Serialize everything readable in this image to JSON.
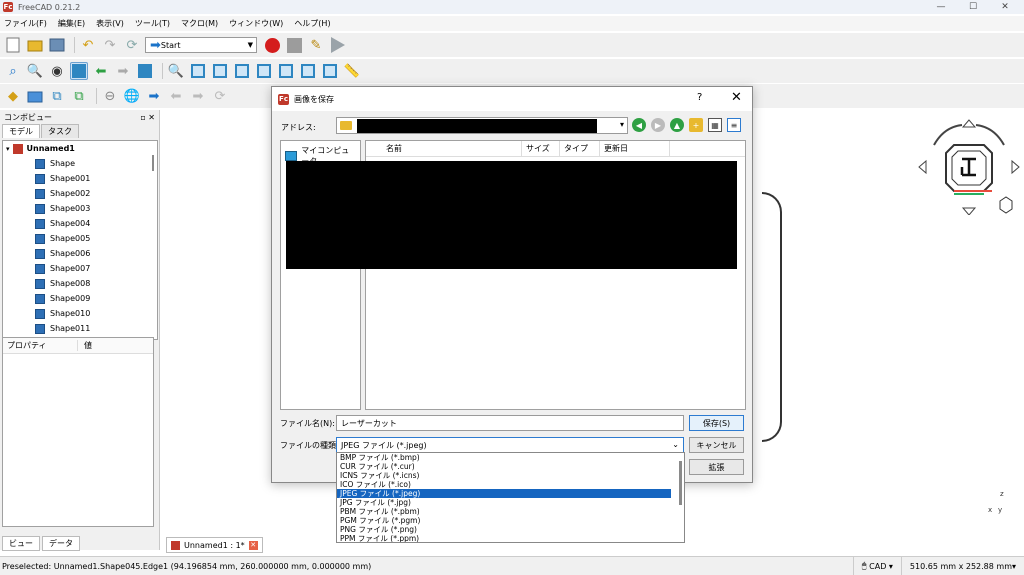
{
  "window": {
    "title": "FreeCAD 0.21.2",
    "app_icon": "Fc",
    "min": "—",
    "max": "☐",
    "close": "✕"
  },
  "menu": [
    "ファイル(F)",
    "編集(E)",
    "表示(V)",
    "ツール(T)",
    "マクロ(M)",
    "ウィンドウ(W)",
    "ヘルプ(H)"
  ],
  "toolbar": {
    "workbench": "Start"
  },
  "combo": {
    "title": "コンボビュー",
    "tabs": [
      "モデル",
      "タスク"
    ],
    "root": "Unnamed1",
    "items": [
      "Shape",
      "Shape001",
      "Shape002",
      "Shape003",
      "Shape004",
      "Shape005",
      "Shape006",
      "Shape007",
      "Shape008",
      "Shape009",
      "Shape010",
      "Shape011"
    ],
    "props_col1": "プロパティ",
    "props_col2": "値",
    "bottom_tabs": [
      "ビュー",
      "データ"
    ]
  },
  "doc_tab": {
    "label": "Unnamed1 : 1*"
  },
  "status": {
    "message": "Preselected: Unnamed1.Shape045.Edge1 (94.196854 mm, 260.000000 mm, 0.000000 mm)",
    "nav": "CAD",
    "dimensions": "510.65 mm x 252.88 mm"
  },
  "axis": {
    "x": "x",
    "z": "z",
    "y": "y"
  },
  "dialog": {
    "title": "画像を保存",
    "help": "?",
    "address_label": "アドレス:",
    "sidebar_item": "マイコンピュータ",
    "columns": [
      "名前",
      "サイズ",
      "タイプ",
      "更新日"
    ],
    "filename_label": "ファイル名(N):",
    "filename_value": "レーザーカット",
    "filetype_label": "ファイルの種類:",
    "filetype_value": "JPEG ファイル (*.jpeg)",
    "save_button": "保存(S)",
    "cancel_button": "キャンセル",
    "extend_button": "拡張",
    "options": [
      "BMP ファイル (*.bmp)",
      "CUR ファイル (*.cur)",
      "ICNS ファイル (*.icns)",
      "ICO ファイル (*.ico)",
      "JPEG ファイル (*.jpeg)",
      "JPG ファイル (*.jpg)",
      "PBM ファイル (*.pbm)",
      "PGM ファイル (*.pgm)",
      "PNG ファイル (*.png)",
      "PPM ファイル (*.ppm)"
    ],
    "selected_index": 4
  }
}
